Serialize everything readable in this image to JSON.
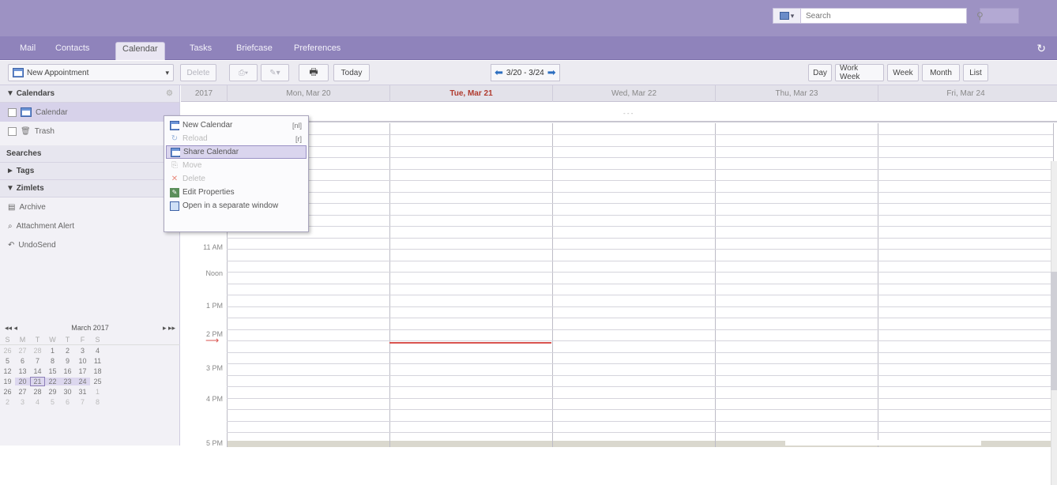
{
  "header": {
    "search_type": "▾",
    "search_placeholder": "Search"
  },
  "tabs": [
    "Mail",
    "Contacts",
    "Calendar",
    "Tasks",
    "Briefcase",
    "Preferences"
  ],
  "active_tab": "Calendar",
  "toolbar": {
    "new_appointment": "New Appointment",
    "delete": "Delete",
    "today": "Today",
    "date_range": "3/20 - 3/24",
    "views": [
      "Day",
      "Work Week",
      "Week",
      "Month",
      "List"
    ]
  },
  "sidebar": {
    "calendars_header": "Calendars",
    "calendars": [
      {
        "label": "Calendar",
        "selected": true
      },
      {
        "label": "Trash",
        "selected": false
      }
    ],
    "searches_header": "Searches",
    "tags_header": "Tags",
    "zimlets_header": "Zimlets",
    "zimlets": [
      "Archive",
      "Attachment Alert",
      "UndoSend"
    ]
  },
  "minical": {
    "title": "March 2017",
    "weekdays": [
      "S",
      "M",
      "T",
      "W",
      "T",
      "F",
      "S"
    ],
    "weeks": [
      [
        "26",
        "27",
        "28",
        "1",
        "2",
        "3",
        "4"
      ],
      [
        "5",
        "6",
        "7",
        "8",
        "9",
        "10",
        "11"
      ],
      [
        "12",
        "13",
        "14",
        "15",
        "16",
        "17",
        "18"
      ],
      [
        "19",
        "20",
        "21",
        "22",
        "23",
        "24",
        "25"
      ],
      [
        "26",
        "27",
        "28",
        "29",
        "30",
        "31",
        "1"
      ],
      [
        "2",
        "3",
        "4",
        "5",
        "6",
        "7",
        "8"
      ]
    ]
  },
  "calendar": {
    "year": "2017",
    "days": [
      {
        "label": "Mon, Mar 20",
        "today": false
      },
      {
        "label": "Tue, Mar 21",
        "today": true
      },
      {
        "label": "Wed, Mar 22",
        "today": false
      },
      {
        "label": "Thu, Mar 23",
        "today": false
      },
      {
        "label": "Fri, Mar 24",
        "today": false
      }
    ],
    "hours": [
      "11 AM",
      "Noon",
      "1 PM",
      "2 PM",
      "3 PM",
      "4 PM",
      "5 PM"
    ],
    "more_indicator": "- - -"
  },
  "context_menu": {
    "items": [
      {
        "label": "New Calendar",
        "shortcut": "[nl]",
        "disabled": false,
        "highlighted": false,
        "icon": "calendar-icon"
      },
      {
        "label": "Reload",
        "shortcut": "[r]",
        "disabled": true,
        "highlighted": false,
        "icon": "reload-icon"
      },
      {
        "label": "Share Calendar",
        "shortcut": "",
        "disabled": false,
        "highlighted": true,
        "icon": "share-icon"
      },
      {
        "label": "Move",
        "shortcut": "",
        "disabled": true,
        "highlighted": false,
        "icon": "move-icon"
      },
      {
        "label": "Delete",
        "shortcut": "",
        "disabled": true,
        "highlighted": false,
        "icon": "delete-icon"
      },
      {
        "label": "Edit Properties",
        "shortcut": "",
        "disabled": false,
        "highlighted": false,
        "icon": "properties-icon"
      },
      {
        "label": "Open in a separate window",
        "shortcut": "",
        "disabled": false,
        "highlighted": false,
        "icon": "window-icon"
      }
    ]
  },
  "colors": {
    "header_bg": "#9d92c3",
    "tabbar_bg": "#8f83bb",
    "today_red": "#b03a2e",
    "now_line": "#d9534f"
  }
}
